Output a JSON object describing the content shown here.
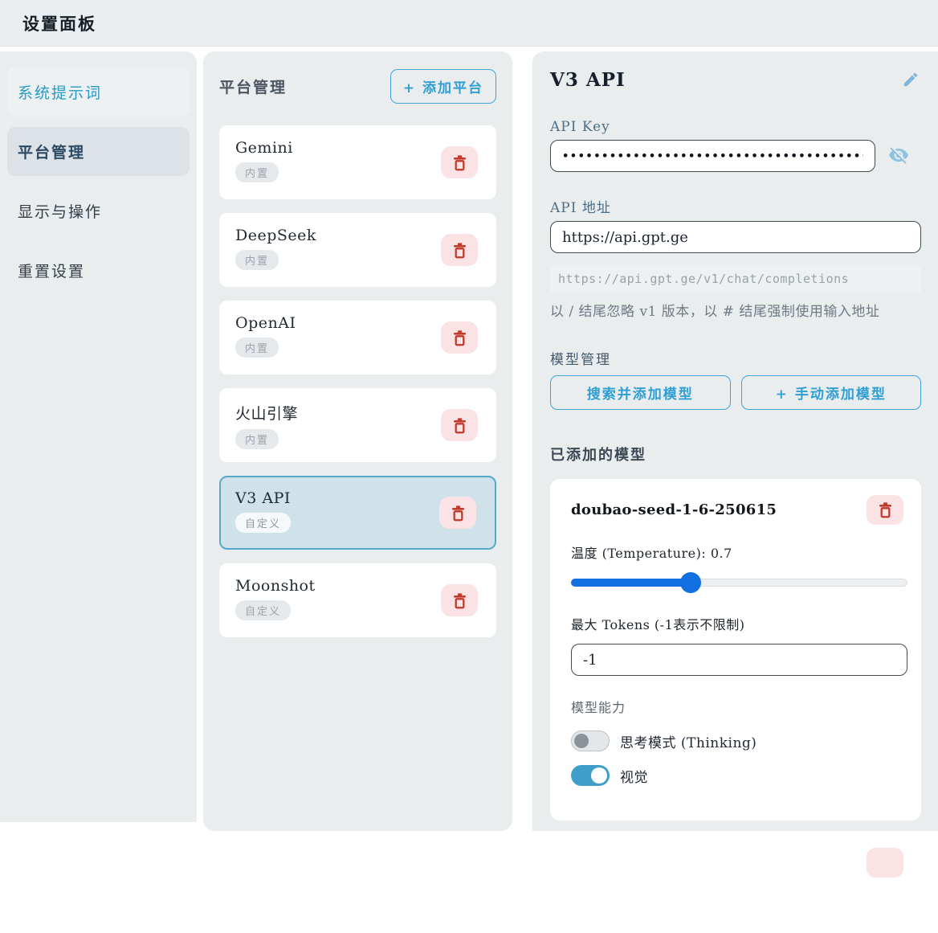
{
  "header": {
    "title": "设置面板"
  },
  "sidebar": {
    "items": [
      {
        "label": "系统提示词"
      },
      {
        "label": "平台管理"
      },
      {
        "label": "显示与操作"
      },
      {
        "label": "重置设置"
      }
    ]
  },
  "platform_panel": {
    "title": "平台管理",
    "add_button_label": "+ 添加平台",
    "platforms": [
      {
        "name": "Gemini",
        "badge": "内置",
        "selected": false
      },
      {
        "name": "DeepSeek",
        "badge": "内置",
        "selected": false
      },
      {
        "name": "OpenAI",
        "badge": "内置",
        "selected": false
      },
      {
        "name": "火山引擎",
        "badge": "内置",
        "selected": false
      },
      {
        "name": "V3 API",
        "badge": "自定义",
        "selected": true
      },
      {
        "name": "Moonshot",
        "badge": "自定义",
        "selected": false
      }
    ]
  },
  "detail_panel": {
    "title": "V3 API",
    "api_key": {
      "label": "API Key",
      "value_masked": "••••••••••••••••••••••••••••••••••••••••••••••"
    },
    "api_url": {
      "label": "API 地址",
      "value": "https://api.gpt.ge",
      "resolved_preview": "https://api.gpt.ge/v1/chat/completions",
      "note": "以 / 结尾忽略 v1 版本，以 # 结尾强制使用输入地址"
    },
    "model_management": {
      "label": "模型管理",
      "search_button_label": "搜索并添加模型",
      "manual_button_label": "+ 手动添加模型"
    },
    "added_models": {
      "heading": "已添加的模型",
      "models": [
        {
          "name": "doubao-seed-1-6-250615",
          "temperature_label": "温度 (Temperature): 0.7",
          "temperature_value": 0.7,
          "temperature_percent": 35.6,
          "max_tokens_label": "最大 Tokens (-1表示不限制)",
          "max_tokens_value": "-1",
          "capabilities_label": "模型能力",
          "toggles": [
            {
              "label": "思考模式 (Thinking)",
              "on": false
            },
            {
              "label": "视觉",
              "on": true
            }
          ]
        }
      ]
    }
  },
  "colors": {
    "panel_bg": "#e9edee",
    "accent_blue": "#2f9fd3",
    "selected_card_bg": "#cfe2ea",
    "selected_card_border": "#58a8cb",
    "danger_red": "#c0392b",
    "danger_bg": "#fbe2e4",
    "slider_blue": "#1270e3",
    "toggle_on_blue": "#3f9fc9",
    "sidebar_active_text": "#2599c6"
  }
}
